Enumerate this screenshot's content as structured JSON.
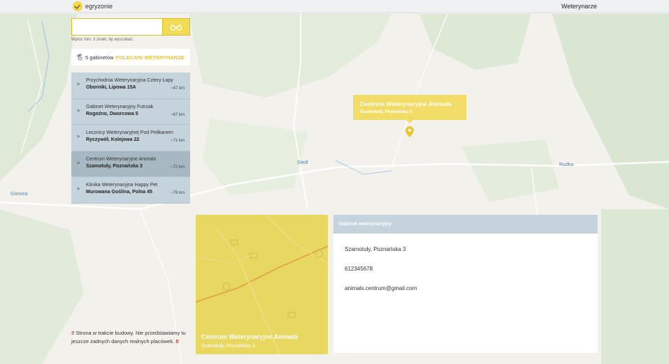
{
  "header": {
    "brand": "egryzonie",
    "nav_link": "Weterynarze"
  },
  "search": {
    "value": "",
    "placeholder": "",
    "hint": "Wpisz min. 3 znaki, by wyszukać."
  },
  "count_bar": {
    "count_text": "5 gabinetów",
    "highlight": "POLECANI WETERYNARZE"
  },
  "clinics": [
    {
      "name": "Przychodnia Weterynaryjna Cztery Łapy",
      "address": "Oborniki, Lipowa 15A",
      "distance": "~47 km"
    },
    {
      "name": "Gabinet Weterynaryjny Futrzak",
      "address": "Rogoźno, Dworcowa 5",
      "distance": "~67 km"
    },
    {
      "name": "Lecznicy Weterynaryjnej Pod Pelikanem",
      "address": "Ryczywół, Kolejowa 22",
      "distance": "~71 km"
    },
    {
      "name": "Centrum Weterynaryjne Animals",
      "address": "Szamotuły, Poznańska 3",
      "distance": "~72 km"
    },
    {
      "name": "Klinika Weterynaryjna Happy Pet",
      "address": "Murowana Goślina, Polna 45",
      "distance": "~79 km"
    }
  ],
  "map": {
    "labels": [
      "Siedl",
      "Rudka",
      "Górnica"
    ],
    "tooltip": {
      "name": "Centrum Weterynaryjne Animals",
      "address": "Szamotuły, Poznańska 3"
    }
  },
  "detail": {
    "photo_name": "Centrum Weterynaryjne Animals",
    "photo_address": "Szamotuły, Poznańska 3",
    "header": "Gabinet weterynaryjny",
    "address": "Szamotuły, Poznańska 3",
    "phone": "612345678",
    "email": "animals.centrum@gmail.com"
  },
  "notice": {
    "bang": "‼",
    "text": "Strona w trakcie budowy. Nie przedstawiamy tu jeszcze żadnych danych realnych placówek."
  },
  "colors": {
    "accent_yellow": "#f3dc55",
    "list_bg": "#c4d3dc",
    "list_active": "#a8b8c2"
  }
}
